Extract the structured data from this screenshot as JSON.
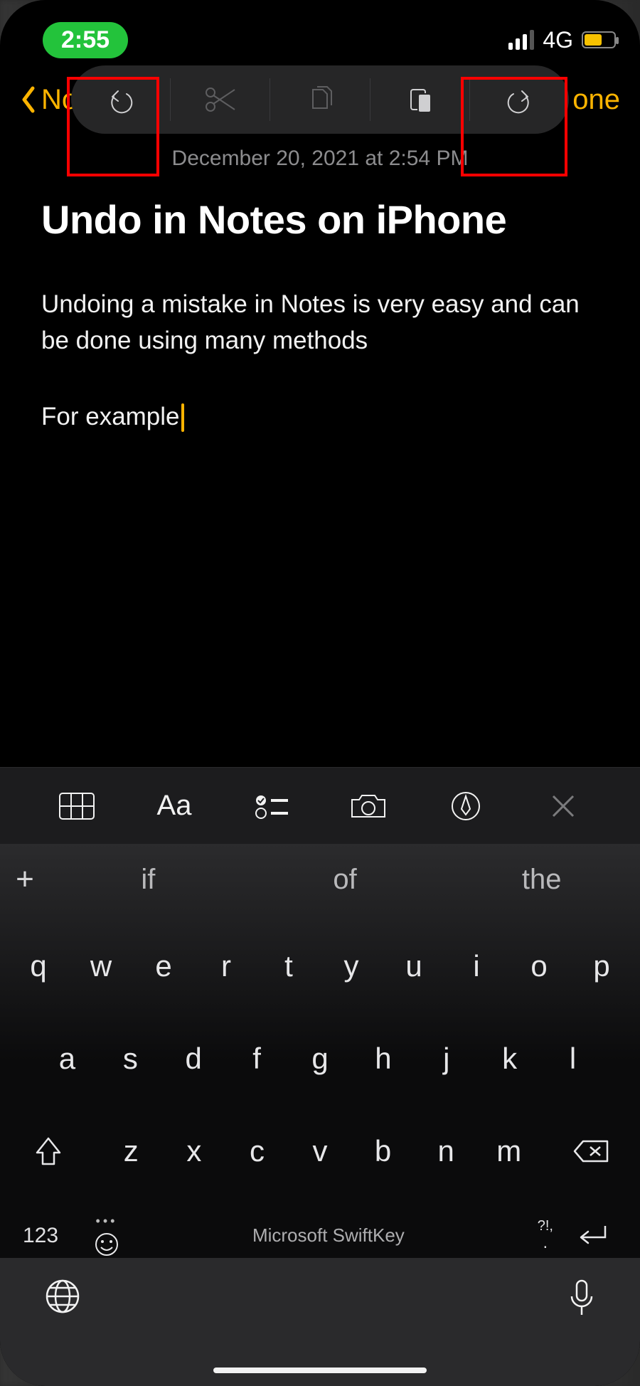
{
  "status": {
    "time": "2:55",
    "network_label": "4G"
  },
  "nav": {
    "back_label": "Notes",
    "done_label": "one"
  },
  "edit_pill": {
    "items": [
      "undo",
      "cut",
      "copy",
      "paste",
      "redo"
    ]
  },
  "note": {
    "date": "December 20, 2021 at 2:54 PM",
    "title": "Undo in Notes on iPhone",
    "body_p1": "Undoing a mistake in Notes is very easy and can be done using many methods",
    "body_p2": "For example"
  },
  "notes_toolbar": {
    "text_style_label": "Aa"
  },
  "keyboard": {
    "suggestions": [
      "if",
      "of",
      "the"
    ],
    "row1": [
      "q",
      "w",
      "e",
      "r",
      "t",
      "y",
      "u",
      "i",
      "o",
      "p"
    ],
    "row2": [
      "a",
      "s",
      "d",
      "f",
      "g",
      "h",
      "j",
      "k",
      "l"
    ],
    "row3": [
      "z",
      "x",
      "c",
      "v",
      "b",
      "n",
      "m"
    ],
    "numeric_label": "123",
    "brand": "Microsoft SwiftKey",
    "punct_upper": "?!,",
    "punct_lower": "."
  },
  "colors": {
    "accent": "#fdb400",
    "pill_green": "#23c33b",
    "highlight": "#ff0000"
  }
}
